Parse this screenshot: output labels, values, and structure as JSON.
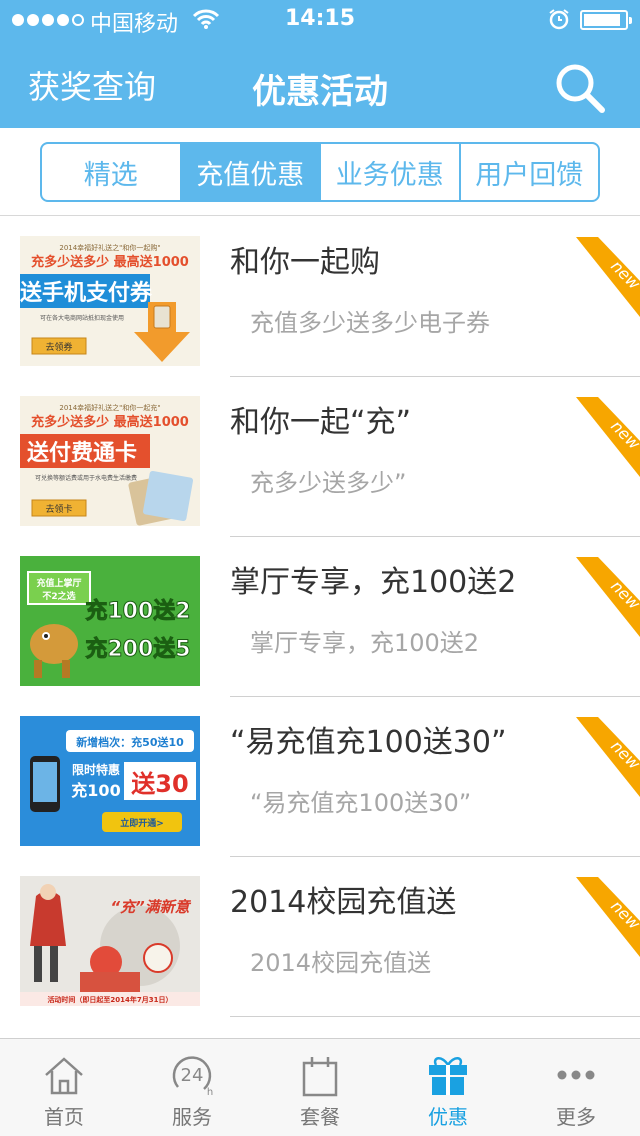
{
  "status_bar": {
    "carrier": "中国移动",
    "time": "14:15"
  },
  "nav": {
    "left_label": "获奖查询",
    "title": "优惠活动",
    "search_icon": "search-icon"
  },
  "segments": [
    {
      "label": "精选",
      "active": false
    },
    {
      "label": "充值优惠",
      "active": true
    },
    {
      "label": "业务优惠",
      "active": false
    },
    {
      "label": "用户回馈",
      "active": false
    }
  ],
  "list": [
    {
      "title": "和你一起购",
      "subtitle": "充值多少送多少电子券",
      "badge": "new",
      "thumb": {
        "line1": "2014幸福好礼送之\"和你一起购\"",
        "line2": "充多少送多少 最高送1000",
        "line3": "送手机支付券",
        "line4": "可在各大电商网站抵扣现金使用",
        "button": "去领券"
      }
    },
    {
      "title": "和你一起“充”",
      "subtitle": "充多少送多少”",
      "badge": "new",
      "thumb": {
        "line1": "2014幸福好礼送之\"和你一起充\"",
        "line2": "充多少送多少 最高送1000",
        "line3": "送付费通卡",
        "line4": "可兑换等额话费或用于水电费生活缴费",
        "button": "去领卡"
      }
    },
    {
      "title": "掌厅专享，充100送2",
      "subtitle": "掌厅专享，充100送2",
      "badge": "new",
      "thumb": {
        "line1": "充值上掌厅",
        "line2": "不2之选",
        "line3": "充100送2",
        "line4": "充200送5"
      }
    },
    {
      "title": "“易充值充100送30”",
      "subtitle": "“易充值充100送30”",
      "badge": "new",
      "thumb": {
        "line1": "新增档次：充50送10",
        "line2": "限时特惠",
        "line3": "充100",
        "line4": "送30",
        "button": "立即开通>"
      }
    },
    {
      "title": "2014校园充值送",
      "subtitle": "2014校园充值送",
      "badge": "new",
      "thumb": {
        "line1": "“充”满新意",
        "line2": "活动时间（即日起至2014年7月31日）"
      }
    }
  ],
  "tabbar": [
    {
      "label": "首页",
      "icon": "home-icon",
      "active": false
    },
    {
      "label": "服务",
      "icon": "24h-icon",
      "active": false
    },
    {
      "label": "套餐",
      "icon": "package-icon",
      "active": false
    },
    {
      "label": "优惠",
      "icon": "gift-icon",
      "active": true
    },
    {
      "label": "更多",
      "icon": "more-icon",
      "active": false
    }
  ],
  "colors": {
    "primary": "#5db8ec",
    "tab_active": "#1aa1e1",
    "badge": "#f7a600"
  }
}
